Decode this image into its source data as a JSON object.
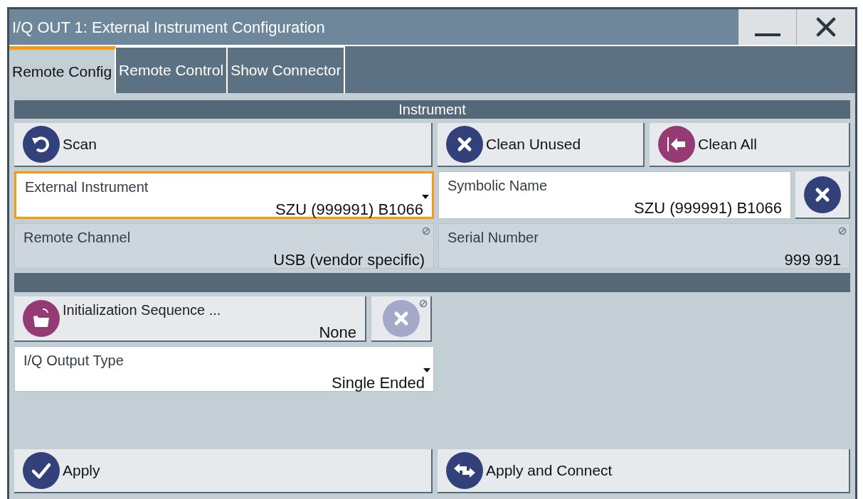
{
  "window": {
    "title": "I/Q OUT 1: External Instrument Configuration"
  },
  "tabs": [
    {
      "label": "Remote Config",
      "selected": true
    },
    {
      "label": "Remote Control",
      "selected": false
    },
    {
      "label": "Show Connector",
      "selected": false
    }
  ],
  "instrument": {
    "title": "Instrument",
    "scan_button": {
      "label": "Scan"
    },
    "clean_unused_button": {
      "label": "Clean Unused"
    },
    "clean_all_button": {
      "label": "Clean All"
    },
    "external_instrument": {
      "kind": "dropdown",
      "label": "External Instrument",
      "value": "SZU (999991) B1066",
      "focused": true,
      "disabled": false
    },
    "symbolic_name": {
      "label": "Symbolic Name",
      "value": "SZU (999991) B1066",
      "focused": false,
      "disabled": false
    },
    "symbolic_name_clear": {
      "disabled": false
    },
    "remote_channel": {
      "label": "Remote Channel",
      "value": "USB (vendor specific)",
      "focused": false,
      "disabled": true
    },
    "serial_number": {
      "label": "Serial Number",
      "value": "999 991",
      "focused": false,
      "disabled": true
    }
  },
  "initialization": {
    "sequence_button": {
      "label": "Initialization Sequence ...",
      "value": "None"
    },
    "sequence_clear": {
      "disabled": true
    },
    "iq_output_type": {
      "kind": "dropdown",
      "label": "I/Q Output Type",
      "value": "Single Ended",
      "focused": false,
      "disabled": false
    }
  },
  "apply_button": {
    "label": "Apply"
  },
  "apply_connect_button": {
    "label": "Apply and Connect"
  }
}
